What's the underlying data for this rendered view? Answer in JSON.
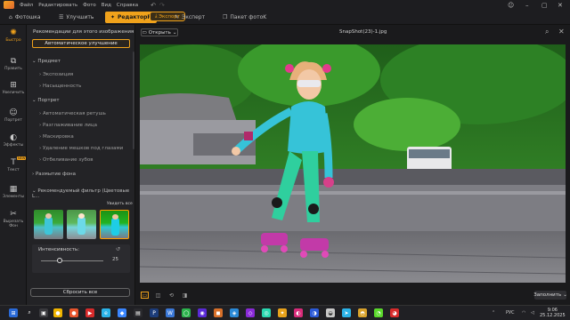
{
  "menubar": {
    "items": [
      "Файл",
      "Редактировать",
      "Фото",
      "Вид",
      "Справка"
    ],
    "undo_icon": "undo-icon",
    "redo_icon": "redo-icon"
  },
  "tabs": {
    "photoshop": "Фотошка",
    "enhance": "Улучшить",
    "editor": "РедакторP",
    "export": "Экспорт",
    "expert": "Эксперт",
    "batch": "Пакет фотоK"
  },
  "leftbar": {
    "items": [
      "Быстро",
      "Править",
      "Увеличить",
      "Портрет",
      "Эффекты",
      "Текст",
      "Элементы",
      "Вырезать Фон"
    ],
    "new_badge": "NEW"
  },
  "panel": {
    "rec_title": "Рекомендации для этого изображения",
    "auto_button": "Автоматическое улучшение",
    "sections": {
      "predmet": "Предмет",
      "portrait": "Портрет",
      "bg_blur": "Размытие фона",
      "rec_filter": "Рекомендуемый фильтр (Цветовые L..."
    },
    "predmet_items": [
      "Экспозиция",
      "Насыщенность"
    ],
    "portrait_items": [
      "Автоматическая ретушь",
      "Разглаживание лица",
      "Маскировка",
      "Удаление мешков под глазами",
      "Отбеливание зубов"
    ],
    "view_all": "Увидеть все",
    "intensity_label": "Интенсивность:",
    "intensity_value": "25",
    "reset_all": "Сбросить все"
  },
  "main": {
    "open_button": "Открыть",
    "filename": "SnapShot(23)-1.jpg",
    "save_button": "Заполнить"
  },
  "taskbar": {
    "lang": "РУС",
    "time": "9:06",
    "date": "25.12.2025"
  },
  "colors": {
    "accent": "#f0a21b",
    "background": "#1b1b1d",
    "panel": "#232326"
  }
}
